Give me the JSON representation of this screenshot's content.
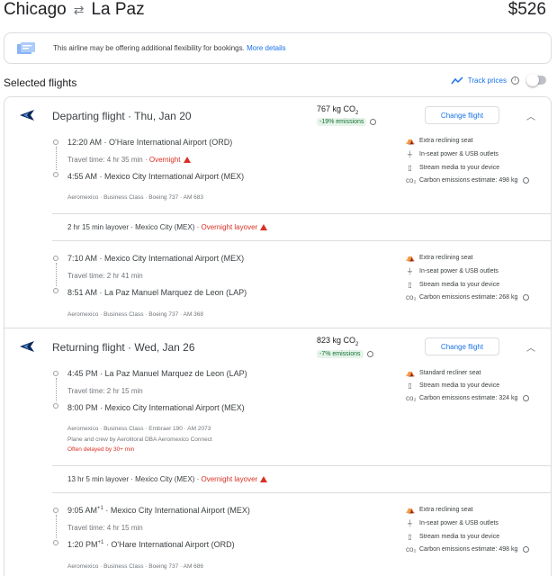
{
  "header": {
    "origin": "Chicago",
    "destination": "La Paz",
    "price": "$526"
  },
  "notice": {
    "text": "This airline may be offering additional flexibility for bookings.",
    "link": "More details"
  },
  "selected": {
    "title": "Selected flights",
    "track_label": "Track prices"
  },
  "departing": {
    "title": "Departing flight · Thu, Jan 20",
    "co2": "767 kg CO",
    "co2_sub": "2",
    "emissions": "-19% emissions",
    "change_label": "Change flight",
    "segments": [
      {
        "dep_time": "12:20 AM",
        "dep_airport": "O'Hare International Airport (ORD)",
        "travel": "Travel time: 4 hr 35 min",
        "travel_note": "Overnight",
        "arr_time": "4:55 AM",
        "arr_airport": "Mexico City International Airport (MEX)",
        "meta": "Aeromexico · Business Class · Boeing 737 · AM 683",
        "amenities": [
          "Extra reclining seat",
          "In-seat power & USB outlets",
          "Stream media to your device",
          "Carbon emissions estimate: 498 kg"
        ]
      },
      {
        "dep_time": "7:10 AM",
        "dep_airport": "Mexico City International Airport (MEX)",
        "travel": "Travel time: 2 hr 41 min",
        "arr_time": "8:51 AM",
        "arr_airport": "La Paz Manuel Marquez de Leon (LAP)",
        "meta": "Aeromexico · Business Class · Boeing 737 · AM 368",
        "amenities": [
          "Extra reclining seat",
          "In-seat power & USB outlets",
          "Stream media to your device",
          "Carbon emissions estimate: 268 kg"
        ]
      }
    ],
    "layover": "2 hr 15 min layover · Mexico City (MEX) ·",
    "layover_note": "Overnight layover"
  },
  "returning": {
    "title": "Returning flight · Wed, Jan 26",
    "co2": "823 kg CO",
    "co2_sub": "2",
    "emissions": "-7% emissions",
    "change_label": "Change flight",
    "segments": [
      {
        "dep_time": "4:45 PM",
        "dep_airport": "La Paz Manuel Marquez de Leon (LAP)",
        "travel": "Travel time: 2 hr 15 min",
        "arr_time": "8:00 PM",
        "arr_airport": "Mexico City International Airport (MEX)",
        "meta": "Aeromexico · Business Class · Embraer 190 · AM 2073",
        "meta2": "Plane and crew by Aerolitoral DBA Aeromexico Connect",
        "delayed": "Often delayed by 30+ min",
        "amenities": [
          "Standard recliner seat",
          "Stream media to your device",
          "Carbon emissions estimate: 324 kg"
        ]
      },
      {
        "dep_time": "9:05 AM",
        "dep_sup": "+1",
        "dep_airport": "Mexico City International Airport (MEX)",
        "travel": "Travel time: 4 hr 15 min",
        "arr_time": "1:20 PM",
        "arr_sup": "+1",
        "arr_airport": "O'Hare International Airport (ORD)",
        "meta": "Aeromexico · Business Class · Boeing 737 · AM 686",
        "amenities": [
          "Extra reclining seat",
          "In-seat power & USB outlets",
          "Stream media to your device",
          "Carbon emissions estimate: 498 kg"
        ]
      }
    ],
    "layover": "13 hr 5 min layover · Mexico City (MEX) ·",
    "layover_note": "Overnight layover"
  }
}
